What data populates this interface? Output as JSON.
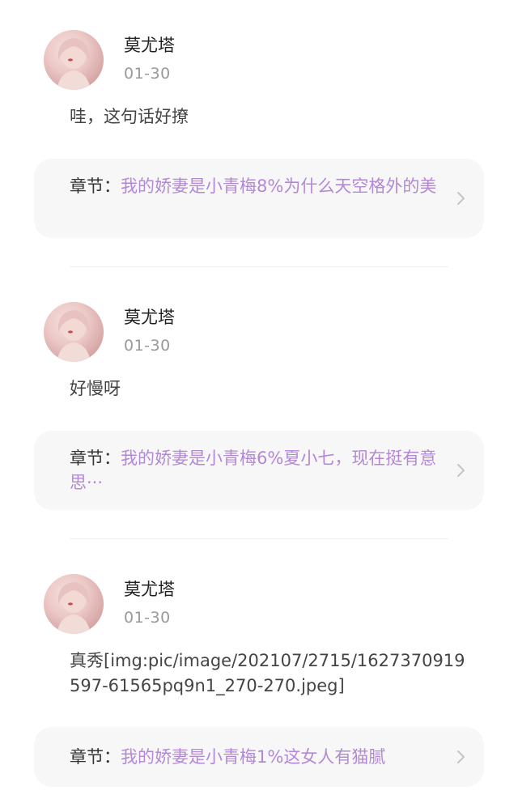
{
  "comments": [
    {
      "username": "莫尤塔",
      "date": "01-30",
      "content": "哇，这句话好撩",
      "chapter_prefix": "章节：",
      "chapter_title": "我的娇妻是小青梅8%为什么天空格外的美"
    },
    {
      "username": "莫尤塔",
      "date": "01-30",
      "content": "好慢呀",
      "chapter_prefix": "章节：",
      "chapter_title": "我的娇妻是小青梅6%夏小七，现在挺有意思···"
    },
    {
      "username": "莫尤塔",
      "date": "01-30",
      "content": "真秀[img:pic/image/202107/2715/1627370919597-61565pq9n1_270-270.jpeg]",
      "chapter_prefix": "章节：",
      "chapter_title": "我的娇妻是小青梅1%这女人有猫腻"
    }
  ],
  "icons": {
    "chevron": "chevron-right-icon",
    "avatar": "user-avatar"
  },
  "colors": {
    "chapter_title": "#b388d6",
    "card_background": "#f7f7f7",
    "date": "#999999"
  }
}
